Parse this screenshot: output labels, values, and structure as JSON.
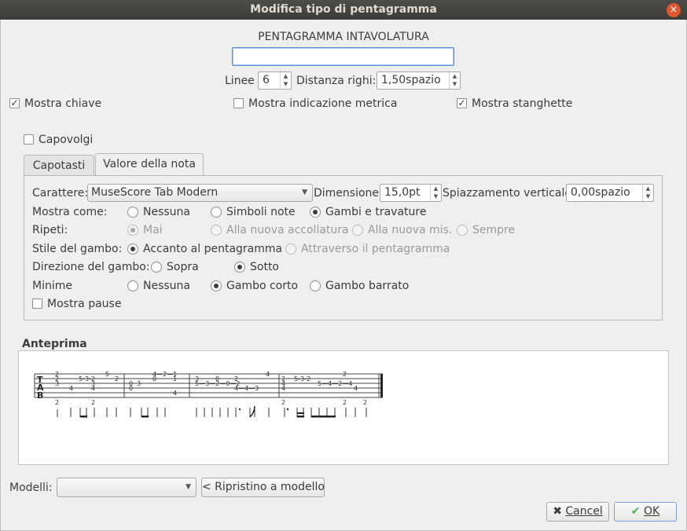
{
  "window": {
    "title": "Modifica tipo di pentagramma",
    "close_symbol": "×"
  },
  "header": {
    "group_name": "PENTAGRAMMA INTAVOLATURA",
    "name_value": ""
  },
  "lines": {
    "label": "Linee",
    "value": "6"
  },
  "spacing": {
    "label": "Distanza righi:",
    "value": "1,50spazio"
  },
  "show": {
    "clef": {
      "label": "Mostra chiave",
      "checked": true
    },
    "timesig": {
      "label": "Mostra indicazione metrica",
      "checked": false
    },
    "barlines": {
      "label": "Mostra stanghette",
      "checked": true
    }
  },
  "flip": {
    "label": "Capovolgi",
    "checked": false
  },
  "tabs": [
    {
      "label": "Capotasti",
      "active": false
    },
    {
      "label": "Valore della nota",
      "active": true
    }
  ],
  "note_values": {
    "font_label": "Carattere:",
    "font_value": "MuseScore Tab Modern",
    "size_label": "Dimensione:",
    "size_value": "15,0pt",
    "voffset_label": "Spiazzamento verticale",
    "voffset_value": "0,00spazio",
    "show_as": {
      "label": "Mostra come:",
      "options": [
        "Nessuna",
        "Simboli note",
        "Gambi e travature"
      ],
      "selected": 2
    },
    "repeat": {
      "label": "Ripeti:",
      "options": [
        "Mai",
        "Alla nuova accollatura",
        "Alla nuova mis.",
        "Sempre"
      ],
      "selected": 0
    },
    "stem_style": {
      "label": "Stile del gambo:",
      "options": [
        "Accanto al pentagramma",
        "Attraverso il pentagramma"
      ],
      "selected": 0
    },
    "stem_dir": {
      "label": "Direzione del gambo:",
      "options": [
        "Sopra",
        "Sotto"
      ],
      "selected": 1
    },
    "minims": {
      "label": "Minime",
      "options": [
        "Nessuna",
        "Gambo corto",
        "Gambo barrato"
      ],
      "selected": 1
    },
    "show_rests": {
      "label": "Mostra pause",
      "checked": false
    }
  },
  "preview": {
    "label": "Anteprima",
    "clef_letters": [
      "T",
      "A",
      "B"
    ]
  },
  "templates": {
    "label": "Modelli:",
    "value": "",
    "reset_label": "< Ripristino a modello"
  },
  "footer": {
    "cancel_label": "Cancel",
    "ok_label": "OK"
  },
  "colors": {
    "titlebar": "#3d3c38",
    "close": "#e0562b",
    "focus": "#5c8fd6",
    "ok_check": "#4caf50"
  }
}
